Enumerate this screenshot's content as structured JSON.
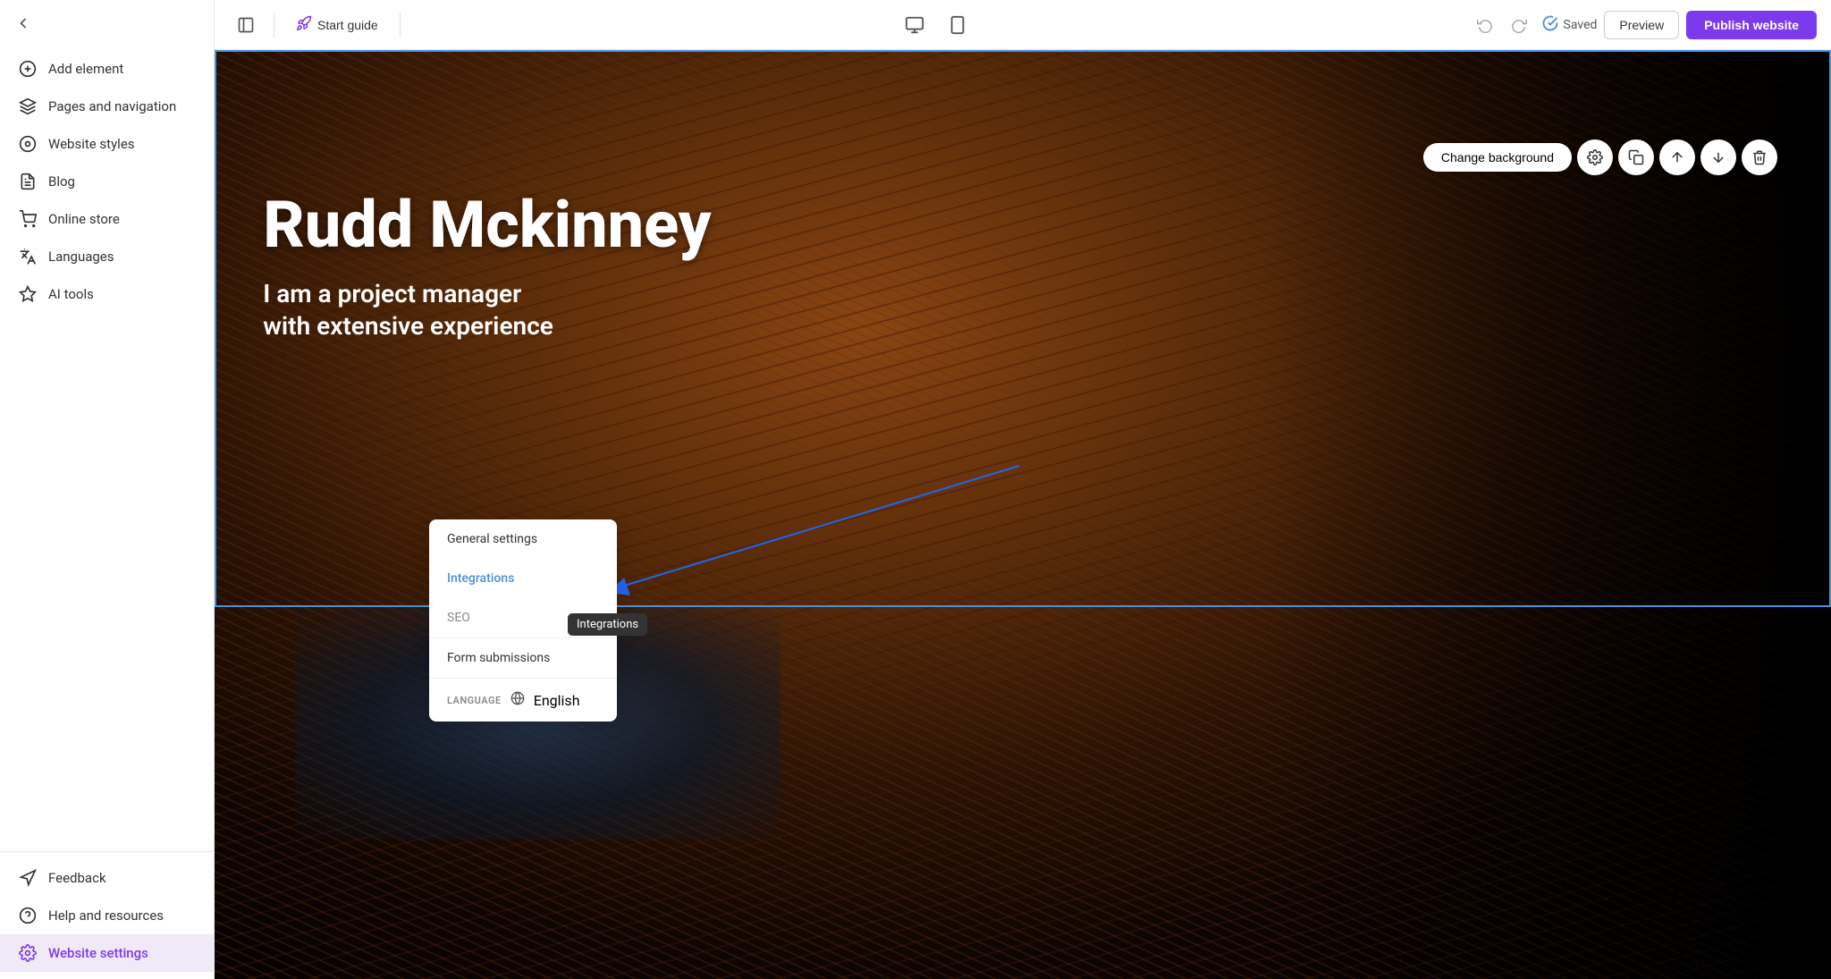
{
  "sidebar": {
    "items": [
      {
        "id": "add-element",
        "label": "Add element",
        "icon": "plus-circle"
      },
      {
        "id": "pages-navigation",
        "label": "Pages and navigation",
        "icon": "layers"
      },
      {
        "id": "website-styles",
        "label": "Website styles",
        "icon": "palette"
      },
      {
        "id": "blog",
        "label": "Blog",
        "icon": "file-text"
      },
      {
        "id": "online-store",
        "label": "Online store",
        "icon": "cart"
      },
      {
        "id": "languages",
        "label": "Languages",
        "icon": "translate"
      },
      {
        "id": "ai-tools",
        "label": "AI tools",
        "icon": "sparkle"
      }
    ],
    "bottom_items": [
      {
        "id": "feedback",
        "label": "Feedback",
        "icon": "megaphone"
      },
      {
        "id": "help-resources",
        "label": "Help and resources",
        "icon": "help-circle"
      },
      {
        "id": "website-settings",
        "label": "Website settings",
        "icon": "gear",
        "active": true
      }
    ]
  },
  "topbar": {
    "start_guide_label": "Start guide",
    "saved_label": "Saved",
    "preview_label": "Preview",
    "publish_label": "Publish website"
  },
  "hero": {
    "title": "Rudd Mckinney",
    "subtitle_line1": "I am a project manager",
    "subtitle_line2": "with extensive experience"
  },
  "floating_toolbar": {
    "change_bg_label": "Change background"
  },
  "dropdown": {
    "items": [
      {
        "id": "general-settings",
        "label": "General settings",
        "active": false
      },
      {
        "id": "integrations",
        "label": "Integrations",
        "active": true
      },
      {
        "id": "seo",
        "label": "SEO",
        "active": false
      },
      {
        "id": "form-submissions",
        "label": "Form submissions",
        "active": false
      }
    ],
    "footer": {
      "language_label": "LANGUAGE",
      "language_icon": "globe",
      "language_value": "English"
    }
  },
  "tooltip": {
    "label": "Integrations"
  }
}
